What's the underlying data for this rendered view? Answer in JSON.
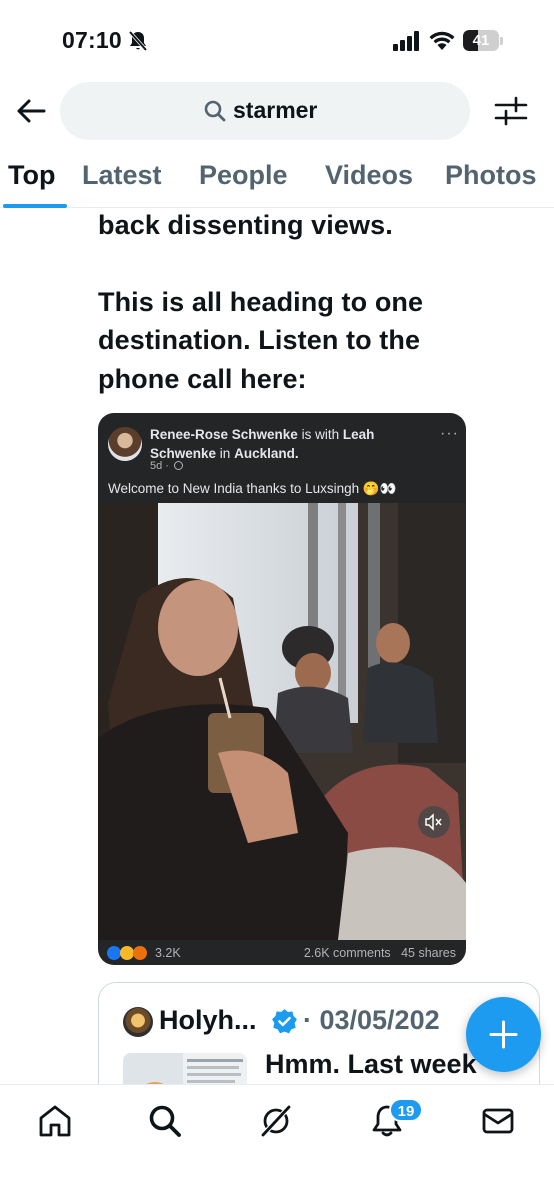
{
  "status_bar": {
    "time": "07:10",
    "battery": "41",
    "battery_level": 0.41
  },
  "search": {
    "query": "starmer"
  },
  "tabs": [
    {
      "label": "Top",
      "active": true
    },
    {
      "label": "Latest",
      "active": false
    },
    {
      "label": "People",
      "active": false
    },
    {
      "label": "Videos",
      "active": false
    },
    {
      "label": "Photos",
      "active": false
    }
  ],
  "tweet": {
    "lines": [
      "back dissenting views.",
      "",
      "This is all heading to one",
      "destination. Listen to the",
      "phone call here:"
    ]
  },
  "embed": {
    "author": "Renee-Rose Schwenke",
    "with_text": "is with",
    "with_name_1": "Leah",
    "with_name_2": "Schwenke",
    "in_text": "in",
    "location": "Auckland.",
    "age": "5d ·",
    "more": "···",
    "caption": "Welcome to New India thanks to Luxsingh 🤭👀",
    "reaction_count": "3.2K",
    "comments": "2.6K comments",
    "shares": "45 shares"
  },
  "quote": {
    "name": "Holyh...",
    "date": "· 03/05/202",
    "text": "Hmm. Last week"
  },
  "nav": {
    "notifications_badge": "19"
  },
  "colors": {
    "accent": "#1d9bf0",
    "text": "#0f1419",
    "muted": "#536471"
  }
}
